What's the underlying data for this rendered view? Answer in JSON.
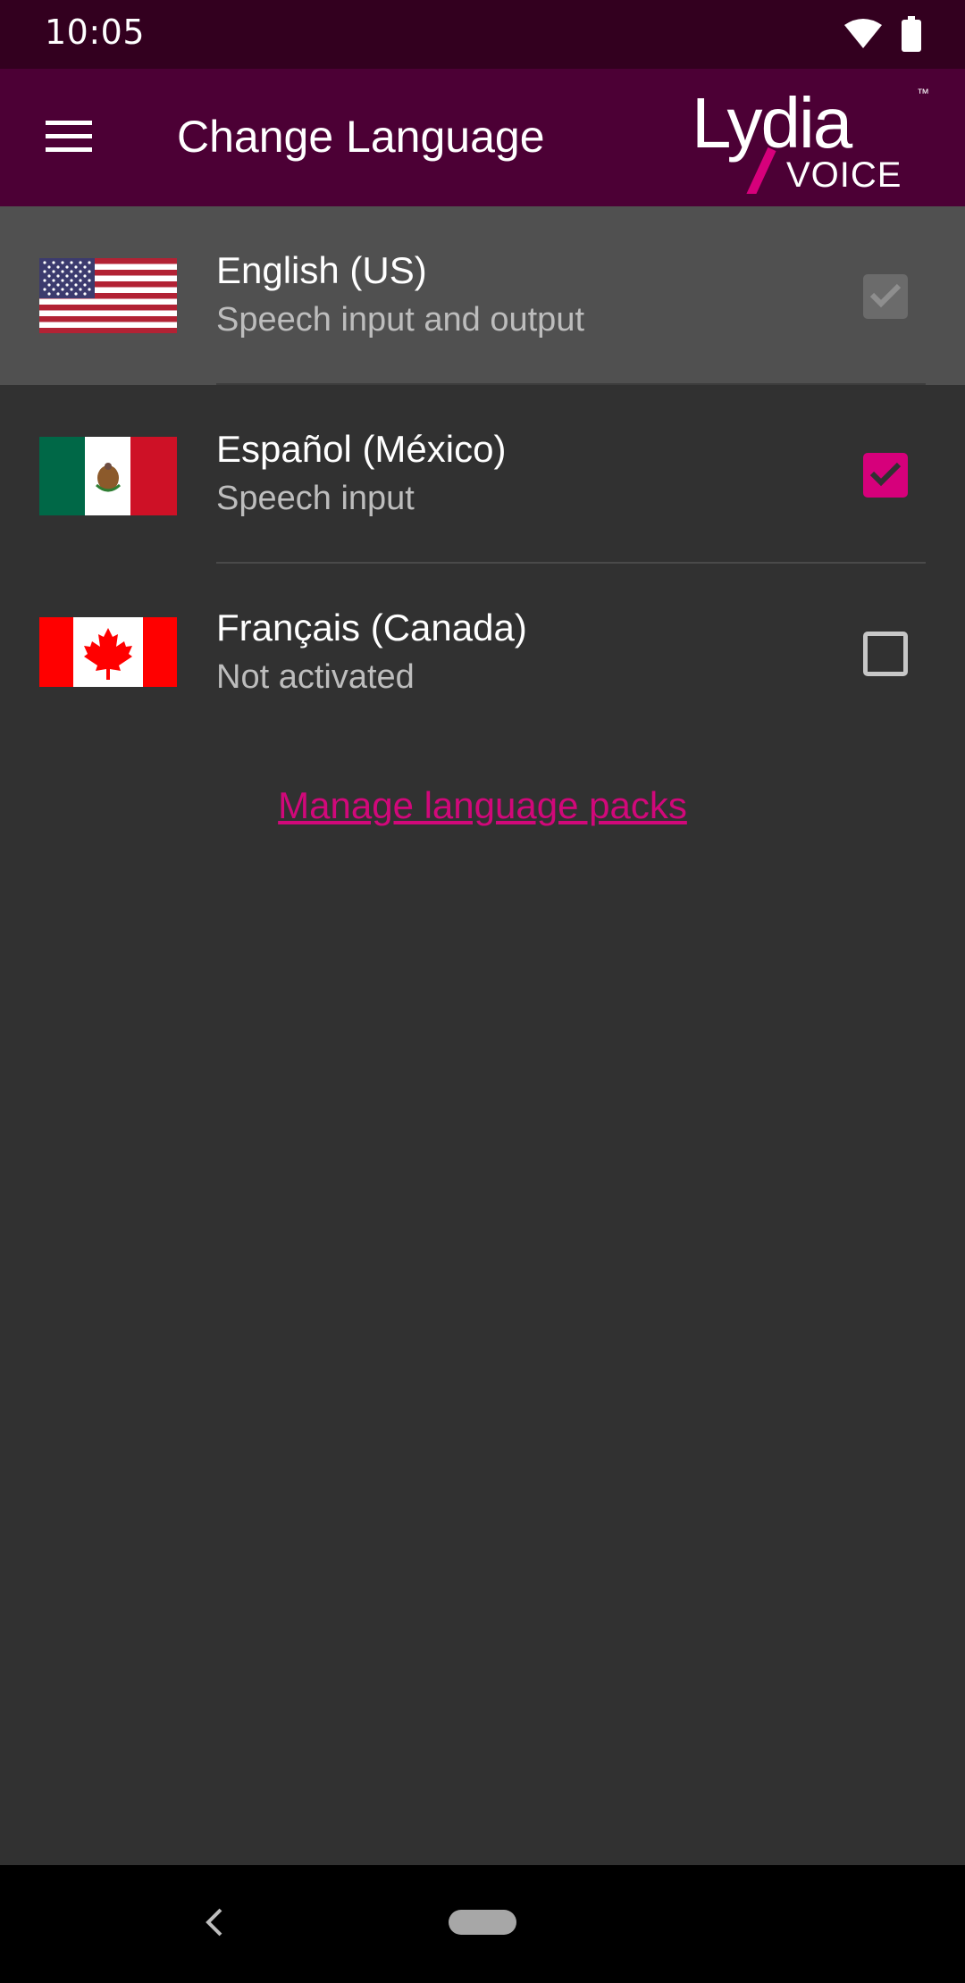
{
  "status_bar": {
    "time": "10:05",
    "icons": [
      "wifi-icon",
      "battery-icon"
    ]
  },
  "app_bar": {
    "menu_icon": "hamburger-menu-icon",
    "title": "Change Language",
    "logo": {
      "brand": "Lydia",
      "sub": "VOICE",
      "trademark": "™"
    }
  },
  "languages": [
    {
      "name": "English (US)",
      "description": "Speech input and output",
      "flag": "us-flag-icon",
      "state": "checked-disabled",
      "selected": true
    },
    {
      "name": "Español (México)",
      "description": "Speech input",
      "flag": "mexico-flag-icon",
      "state": "checked",
      "selected": false
    },
    {
      "name": "Français (Canada)",
      "description": "Not activated",
      "flag": "canada-flag-icon",
      "state": "unchecked",
      "selected": false
    }
  ],
  "manage_link": "Manage language packs",
  "colors": {
    "status_bar": "#33001f",
    "app_bar": "#4c0035",
    "accent": "#d6007b",
    "background": "#313131",
    "selected_row": "#505050"
  },
  "nav_bar": {
    "back_icon": "back-chevron-icon",
    "home_icon": "home-pill-icon"
  }
}
